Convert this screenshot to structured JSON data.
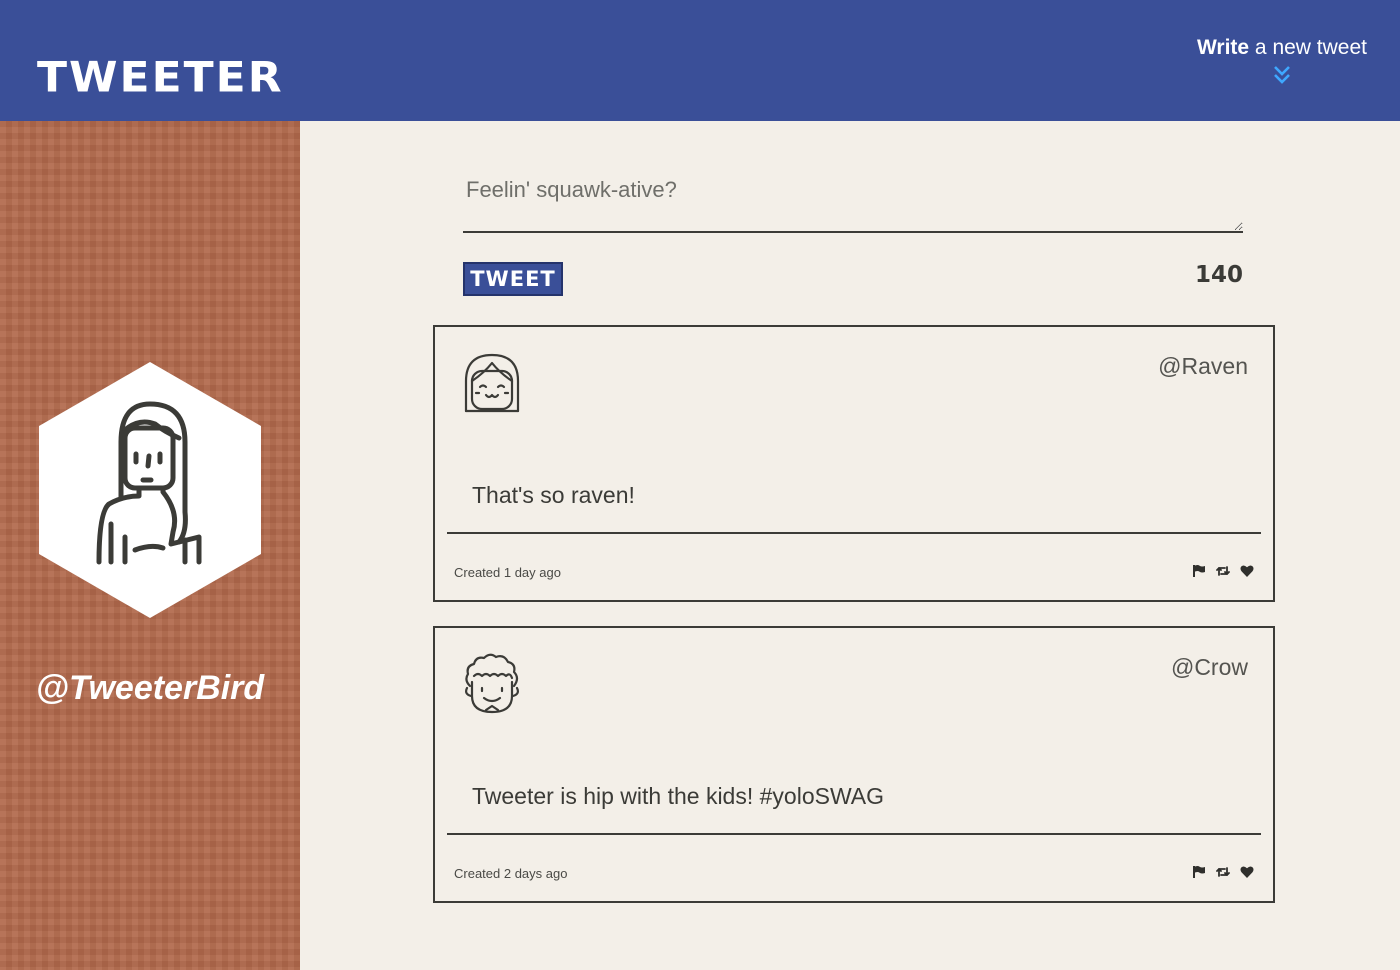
{
  "header": {
    "logo": "TWEETER",
    "compose_bold": "Write",
    "compose_rest": " a new tweet",
    "chevron_color": "#3ea8ff"
  },
  "sidebar": {
    "handle": "@TweeterBird"
  },
  "composer": {
    "placeholder": "Feelin' squawk-ative?",
    "button_label": "TWEET",
    "counter": "140"
  },
  "tweets": [
    {
      "handle": "@Raven",
      "content": "That's so raven!",
      "created": "Created 1 day ago",
      "avatar_icon": "smiling-girl-avatar-icon"
    },
    {
      "handle": "@Crow",
      "content": "Tweeter is hip with the kids! #yoloSWAG",
      "created": "Created 2 days ago",
      "avatar_icon": "curly-hair-boy-avatar-icon"
    }
  ],
  "colors": {
    "header": "#3a4f98",
    "sidebar": "#b2694c",
    "background": "#f3efe8",
    "ink": "#3b3b37"
  }
}
